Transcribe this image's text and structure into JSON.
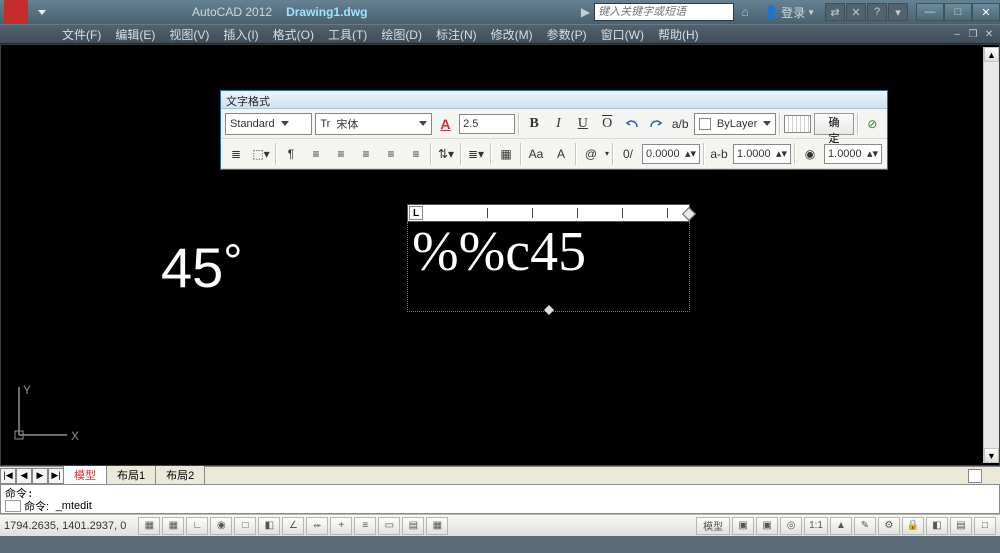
{
  "title": {
    "app": "AutoCAD 2012",
    "doc": "Drawing1.dwg"
  },
  "search": {
    "placeholder": "键入关键字或短语"
  },
  "login": {
    "label": "登录",
    "arrow": "▼"
  },
  "help_icons": {
    "exchange": "⇄",
    "cross": "✕",
    "help": "?",
    "down": "▾"
  },
  "win": {
    "min": "—",
    "max": "□",
    "close": "✕"
  },
  "menu": [
    "文件(F)",
    "编辑(E)",
    "视图(V)",
    "插入(I)",
    "格式(O)",
    "工具(T)",
    "绘图(D)",
    "标注(N)",
    "修改(M)",
    "参数(P)",
    "窗口(W)",
    "帮助(H)"
  ],
  "inner_win": {
    "min": "–",
    "max": "❐",
    "close": "✕"
  },
  "textformat": {
    "title": "文字格式",
    "style": "Standard",
    "font_prefix": "Tr",
    "font": "宋体",
    "height": "2.5",
    "color_layer": "ByLayer",
    "ok": "确定",
    "tracking": "0.0000",
    "width_factor": "1.0000",
    "oblique": "1.0000",
    "at": "@",
    "zero": "0/",
    "ab": "a-b",
    "eye": "◉",
    "Aa": "Aa",
    "A_sub": "A",
    "cols": "≣"
  },
  "drawing": {
    "text1": "45",
    "deg": "°",
    "mtext_ruler_L": "L",
    "mtext_content": "%%c45"
  },
  "ucs": {
    "x": "X",
    "y": "Y"
  },
  "layouts": {
    "navs": [
      "|◀",
      "◀",
      "▶",
      "▶|"
    ],
    "tabs": [
      "模型",
      "布局1",
      "布局2"
    ],
    "active": 0
  },
  "cmd": {
    "line1": "命令:",
    "prompt": "命令:",
    "input": "_mtedit"
  },
  "status": {
    "coords": "1794.2635, 1401.2937, 0",
    "right_model": "模型",
    "scale": "1:1",
    "ann": "▲"
  }
}
